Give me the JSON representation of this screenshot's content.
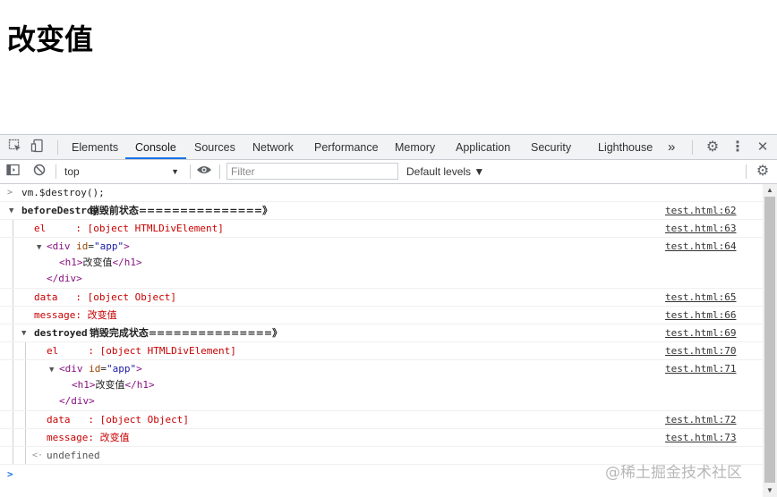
{
  "page": {
    "heading": "改变值"
  },
  "devtools": {
    "tabs": [
      "Elements",
      "Console",
      "Sources",
      "Network",
      "Performance",
      "Memory",
      "Application",
      "Security",
      "Lighthouse"
    ],
    "more_tabs": "»",
    "context": "top",
    "filter_placeholder": "Filter",
    "levels": "Default levels ▼"
  },
  "console": {
    "input_cmd": "vm.$destroy();",
    "before_label": "beforeDestroy",
    "before_text": " 销毁前状态===============》",
    "before_link": "test.html:62",
    "el_label": "el     : [object HTMLDivElement]",
    "el_link": "test.html:63",
    "div_open_tag": "<div",
    "div_attr": "id",
    "div_attr_val": "\"app\"",
    "div_close_bracket": ">",
    "h1_open": "<h1>",
    "h1_text": "改变值",
    "h1_close": "</h1>",
    "div_close": "</div>",
    "div_link": "test.html:64",
    "data_label": "data   : [object Object]",
    "data_link": "test.html:65",
    "message_label": "message: ",
    "message_value": "改变值",
    "message_link": "test.html:66",
    "destroyed_label": "destroyed",
    "destroyed_text": " 销毁完成状态===============》",
    "destroyed_link": "test.html:69",
    "el2_link": "test.html:70",
    "div2_link": "test.html:71",
    "data2_link": "test.html:72",
    "message2_link": "test.html:73",
    "result": "undefined"
  },
  "watermark": "@稀土掘金技术社区"
}
